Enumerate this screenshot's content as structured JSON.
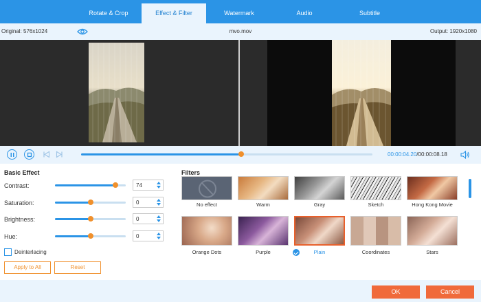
{
  "tabs": [
    {
      "label": "Rotate & Crop"
    },
    {
      "label": "Effect & Filter"
    },
    {
      "label": "Watermark"
    },
    {
      "label": "Audio"
    },
    {
      "label": "Subtitle"
    }
  ],
  "infobar": {
    "original": "Original: 576x1024",
    "filename": "mvo.mov",
    "output": "Output: 1920x1080"
  },
  "playback": {
    "current_time": "00:00:04.20",
    "separator": "/",
    "total_time": "00:00:08.18",
    "progress": 0.55
  },
  "basic_effect": {
    "title": "Basic Effect",
    "contrast": {
      "label": "Contrast:",
      "value": "74",
      "level": 0.85
    },
    "saturation": {
      "label": "Saturation:",
      "value": "0",
      "level": 0.5
    },
    "brightness": {
      "label": "Brightness:",
      "value": "0",
      "level": 0.5
    },
    "hue": {
      "label": "Hue:",
      "value": "0",
      "level": 0.5
    },
    "deinterlacing": {
      "label": "Deinterlacing",
      "checked": false
    },
    "apply_to_all": "Apply to All",
    "reset": "Reset"
  },
  "filters": {
    "title": "Filters",
    "selected": "Plain",
    "items": [
      {
        "label": "No effect"
      },
      {
        "label": "Warm"
      },
      {
        "label": "Gray"
      },
      {
        "label": "Sketch"
      },
      {
        "label": "Hong Kong Movie"
      },
      {
        "label": "Orange Dots"
      },
      {
        "label": "Purple"
      },
      {
        "label": "Plain"
      },
      {
        "label": "Coordinates"
      },
      {
        "label": "Stars"
      }
    ]
  },
  "footer": {
    "ok": "OK",
    "cancel": "Cancel"
  },
  "colors": {
    "accent": "#2b94e6",
    "orange": "#f0902c",
    "button": "#f06a3b"
  }
}
